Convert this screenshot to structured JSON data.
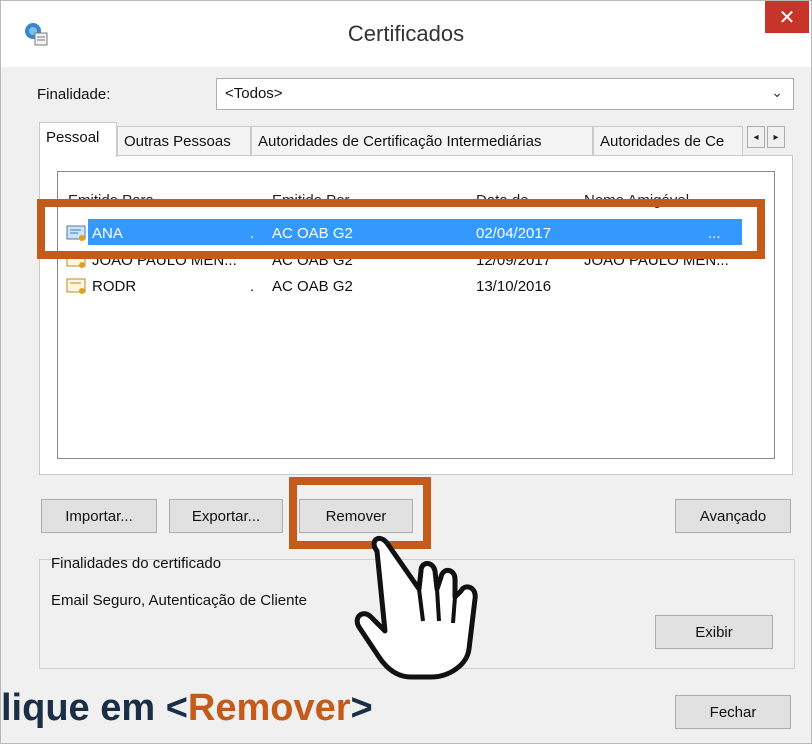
{
  "window": {
    "title": "Certificados",
    "close_glyph": "✕"
  },
  "purpose": {
    "label": "Finalidade:",
    "value": "<Todos>"
  },
  "tabs": [
    {
      "label": "Pessoal"
    },
    {
      "label": "Outras Pessoas"
    },
    {
      "label": "Autoridades de Certificação Intermediárias"
    },
    {
      "label": "Autoridades de Ce"
    }
  ],
  "tab_scroll": {
    "left": "◂",
    "right": "▸"
  },
  "columns": [
    "Emitido Para",
    "Emitido Por",
    "Data de ...",
    "Nome Amigável"
  ],
  "rows": [
    {
      "issued_to": "ANA",
      "issued_by": "AC OAB G2",
      "date": "02/04/2017",
      "friendly": "...",
      "selected": true
    },
    {
      "issued_to": "JOAO PAULO MEN...",
      "issued_by": "AC OAB G2",
      "date": "12/09/2017",
      "friendly": "JOAO PAULO MEN...",
      "selected": false
    },
    {
      "issued_to": "RODR",
      "issued_by": "AC OAB G2",
      "date": "13/10/2016",
      "friendly": "",
      "selected": false
    }
  ],
  "buttons": {
    "import": "Importar...",
    "export": "Exportar...",
    "remove": "Remover",
    "advanced": "Avançado",
    "view": "Exibir",
    "close": "Fechar"
  },
  "purposes_group": {
    "title": "Finalidades do certificado",
    "text": "Email Seguro, Autenticação de Cliente"
  },
  "caption": {
    "prefix": "lique em <",
    "accent": "Remover",
    "suffix": ">"
  },
  "colors": {
    "highlight": "#c55b1b",
    "selection": "#3399ff",
    "close": "#c7352a"
  }
}
